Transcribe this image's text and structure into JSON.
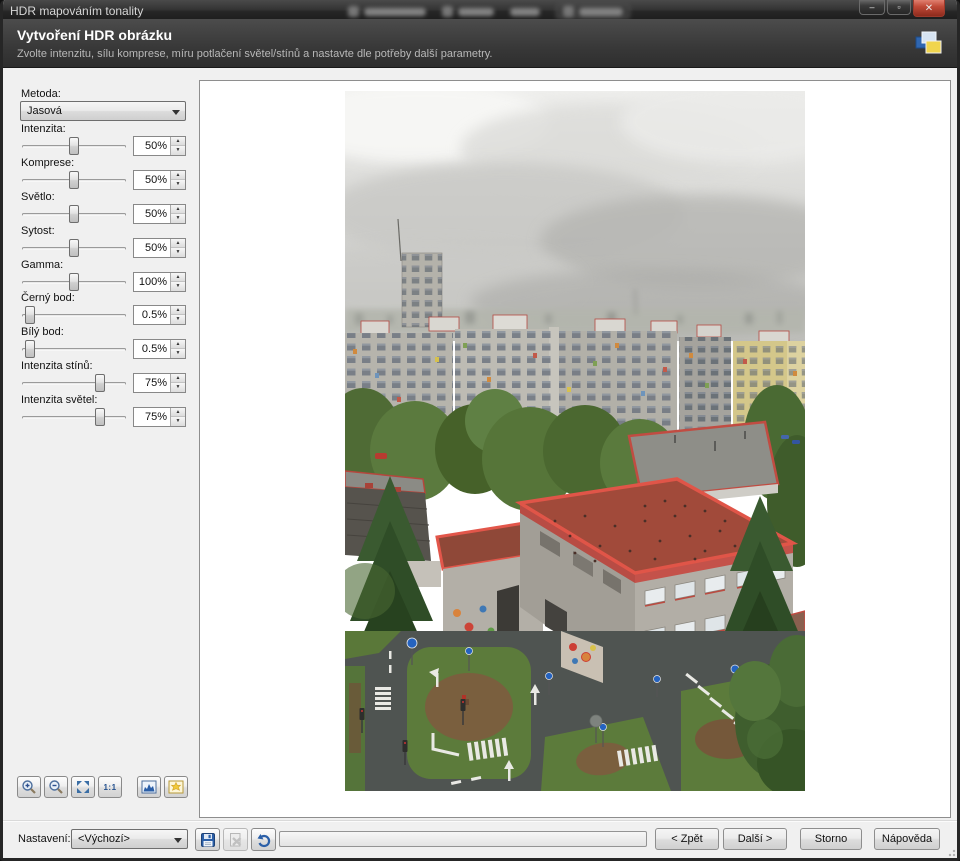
{
  "window": {
    "title": "HDR mapováním tonality"
  },
  "header": {
    "title": "Vytvoření HDR obrázku",
    "subtitle": "Zvolte intenzitu, sílu komprese, míru potlačení světel/stínů a nastavte dle potřeby další parametry."
  },
  "panel": {
    "method": {
      "label": "Metoda:",
      "value": "Jasová"
    },
    "sliders": [
      {
        "label": "Intenzita:",
        "value": "50%",
        "pos": 50
      },
      {
        "label": "Komprese:",
        "value": "50%",
        "pos": 50
      },
      {
        "label": "Světlo:",
        "value": "50%",
        "pos": 50
      },
      {
        "label": "Sytost:",
        "value": "50%",
        "pos": 50
      },
      {
        "label": "Gamma:",
        "value": "100%",
        "pos": 50
      },
      {
        "label": "Černý bod:",
        "value": "0.5%",
        "pos": 8
      },
      {
        "label": "Bílý bod:",
        "value": "0.5%",
        "pos": 8
      },
      {
        "label": "Intenzita stínů:",
        "value": "75%",
        "pos": 75
      },
      {
        "label": "Intenzita světel:",
        "value": "75%",
        "pos": 75
      }
    ]
  },
  "zoom_toolbar": {
    "actual_label": "1:1",
    "icon_names": [
      "zoom-in",
      "zoom-out",
      "fit-to-window",
      "actual-size",
      "histogram",
      "clipping-warning"
    ]
  },
  "footer": {
    "settings_label": "Nastavení:",
    "settings_value": "<Výchozí>",
    "back": "< Zpět",
    "next": "Další >",
    "cancel": "Storno",
    "help": "Nápověda"
  },
  "icons": {
    "minimize": "–",
    "maximize": "▫",
    "close": "✕",
    "spin_up": "▲",
    "spin_down": "▼"
  },
  "colors": {
    "close_button_red": "#c14a38",
    "header_dark": "#383838",
    "dialog_gray": "#f0f0f0",
    "roof_red": "#a14a3a",
    "trim_red": "#e05548"
  }
}
